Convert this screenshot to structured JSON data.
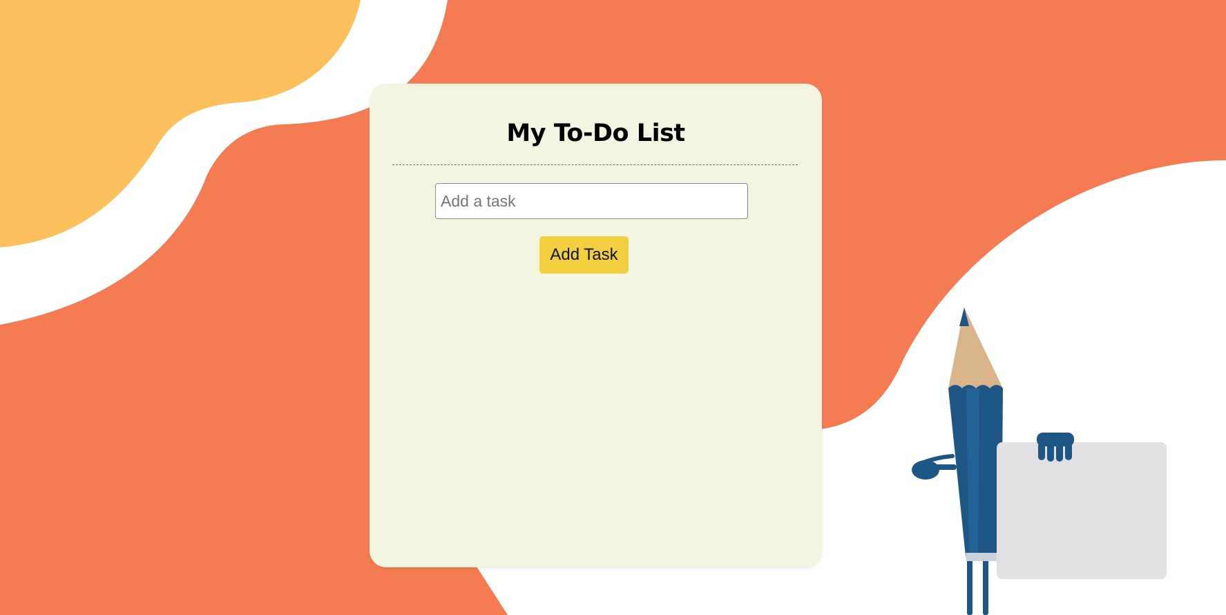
{
  "todo": {
    "title": "My To-Do List",
    "input_placeholder": "Add a task",
    "input_value": "",
    "add_button_label": "Add Task",
    "tasks": []
  },
  "colors": {
    "background_orange": "#F47B51",
    "background_yellow": "#FBBF5C",
    "background_white": "#FFFFFF",
    "card_background": "#F4F5E0",
    "button_yellow": "#F1CF3F",
    "pencil_blue": "#1D5585"
  },
  "decorations": {
    "mascot": "pencil-character-holding-blank-sign"
  }
}
